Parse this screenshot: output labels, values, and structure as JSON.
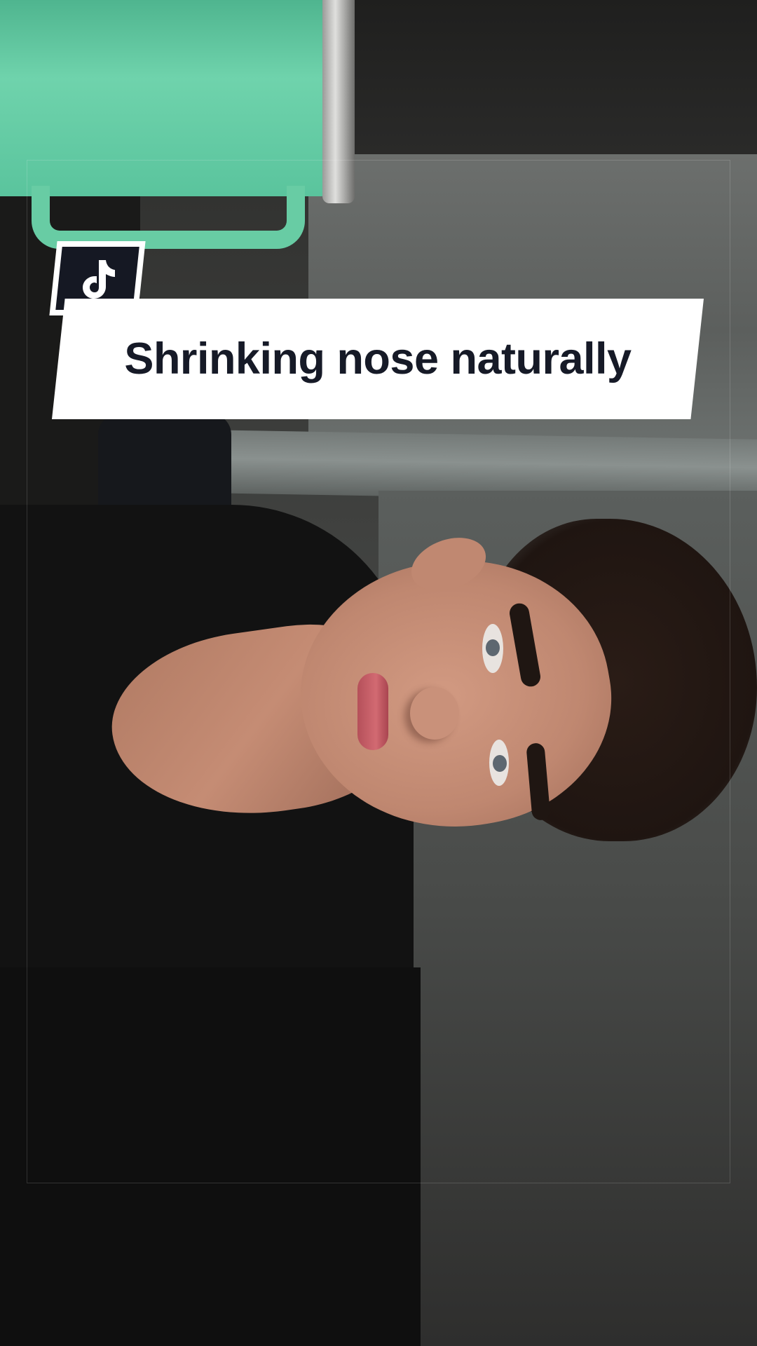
{
  "video": {
    "title_overlay": "Shrinking nose naturally"
  },
  "branding": {
    "logo": "tiktok-logo-icon"
  },
  "colors": {
    "banner_background": "#ffffff",
    "banner_text": "#161a27",
    "logo_background": "#151823"
  }
}
